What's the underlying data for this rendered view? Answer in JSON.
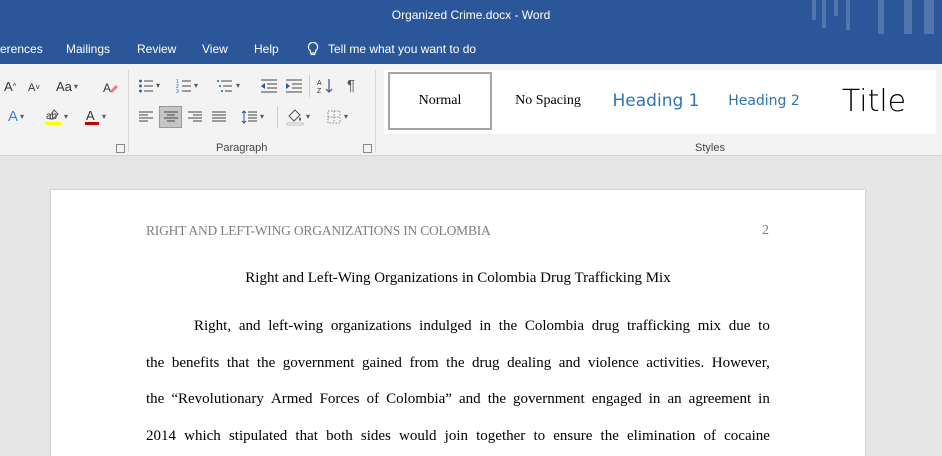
{
  "window": {
    "title": "Organized Crime.docx  -  Word"
  },
  "menu": {
    "tabs": [
      "erences",
      "Mailings",
      "Review",
      "View",
      "Help"
    ],
    "tell_me": "Tell me what you want to do"
  },
  "ribbon": {
    "font_group": {
      "aa_label": "Aa"
    },
    "paragraph_group": {
      "label": "Paragraph"
    },
    "styles_group": {
      "label": "Styles",
      "items": [
        "Normal",
        "No Spacing",
        "Heading 1",
        "Heading 2",
        "Title"
      ],
      "selected": "Normal"
    }
  },
  "colors": {
    "title_bar": "#2b579a",
    "heading_style": "#2e74b5",
    "highlight": "#ffff00",
    "font_color": "#c00000"
  },
  "document": {
    "header": "RIGHT AND LEFT-WING ORGANIZATIONS IN COLOMBIA",
    "page_number": "2",
    "title": "Right and Left-Wing Organizations in Colombia Drug Trafficking Mix",
    "lines": [
      "Right, and left-wing organizations indulged in the Colombia drug trafficking mix due to",
      "the benefits that the government gained from the drug dealing and violence activities. However,",
      "the “Revolutionary Armed Forces of Colombia” and the government engaged in an agreement in",
      "2014 which stipulated that both sides would join together to ensure the elimination of cocaine"
    ]
  }
}
